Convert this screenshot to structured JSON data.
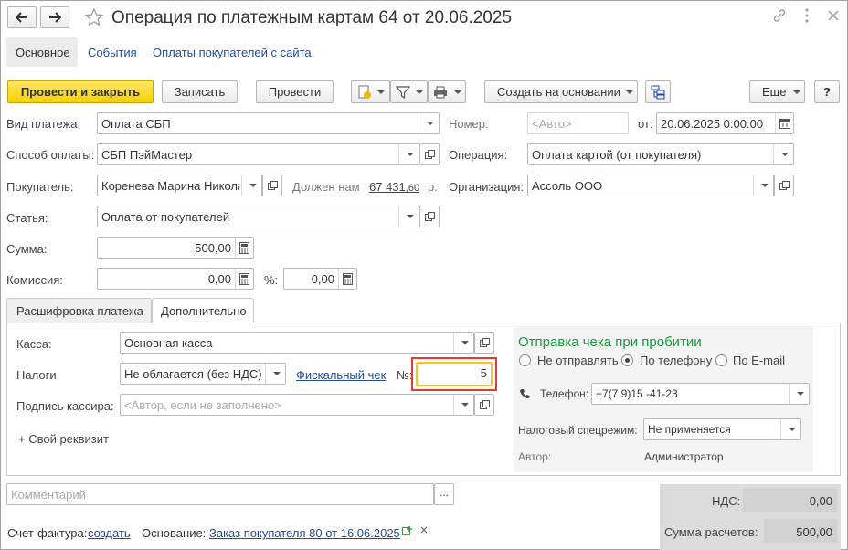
{
  "window": {
    "title": "Операция по платежным картам 64 от 20.06.2025"
  },
  "nav_tabs": [
    "Основное",
    "События",
    "Оплаты покупателей с сайта"
  ],
  "toolbar": {
    "post_close": "Провести и закрыть",
    "save": "Записать",
    "post": "Провести",
    "create_based": "Создать на основании",
    "more": "Еще",
    "help": "?"
  },
  "fields": {
    "payment_type": {
      "label": "Вид платежа:",
      "value": "Оплата СБП"
    },
    "payment_method": {
      "label": "Способ оплаты:",
      "value": "СБП ПэйМастер"
    },
    "buyer": {
      "label": "Покупатель:",
      "value": "Коренева Марина Никола"
    },
    "debt": {
      "label": "Должен нам",
      "value": "67 431",
      "cents": ",60",
      "unit": "р."
    },
    "article": {
      "label": "Статья:",
      "value": "Оплата от покупателей"
    },
    "sum": {
      "label": "Сумма:",
      "value": "500,00"
    },
    "commission": {
      "label": "Комиссия:",
      "value": "0,00"
    },
    "percent": {
      "label": "%:",
      "value": "0,00"
    },
    "number": {
      "label": "Номер:",
      "placeholder": "<Авто>"
    },
    "date": {
      "label": "от:",
      "value": "20.06.2025  0:00:00"
    },
    "operation": {
      "label": "Операция:",
      "value": "Оплата картой (от покупателя)"
    },
    "organization": {
      "label": "Организация:",
      "value": "Ассоль ООО"
    }
  },
  "inner_tabs": [
    "Расшифровка платежа",
    "Дополнительно"
  ],
  "extra": {
    "cash": {
      "label": "Касса:",
      "value": "Основная касса"
    },
    "taxes": {
      "label": "Налоги:",
      "value": "Не облагается (без НДС)"
    },
    "fiscal_link": "Фискальный чек",
    "num_label": "№:",
    "num_value": "5",
    "cashier": {
      "label": "Подпись кассира:",
      "placeholder": "<Автор, если не заполнено>"
    },
    "own_prop": "+ Свой реквизит"
  },
  "receipt": {
    "title": "Отправка чека при пробитии",
    "options": [
      "Не отправлять",
      "По телефону",
      "По E-mail"
    ],
    "selected": 1,
    "phone_label": "Телефон:",
    "phone_value": "+7(7 9)15 -41-23",
    "tax_mode_label": "Налоговый спецрежим:",
    "tax_mode_value": "Не применяется",
    "author_label": "Автор:",
    "author_value": "Администратор"
  },
  "comment_placeholder": "Комментарий",
  "footer": {
    "invoice_label": "Счет-фактура:",
    "invoice_link": "создать",
    "basis_label": "Основание:",
    "basis_link": "Заказ покупателя 80 от 16.06.2025",
    "vat_label": "НДС:",
    "vat_value": "0,00",
    "total_label": "Сумма расчетов:",
    "total_value": "500,00"
  },
  "colors": {
    "primary_button": "#f6d100",
    "link": "#1f4a9c",
    "receipt_title": "#1a9a3a",
    "highlight_border": "#e53935"
  }
}
